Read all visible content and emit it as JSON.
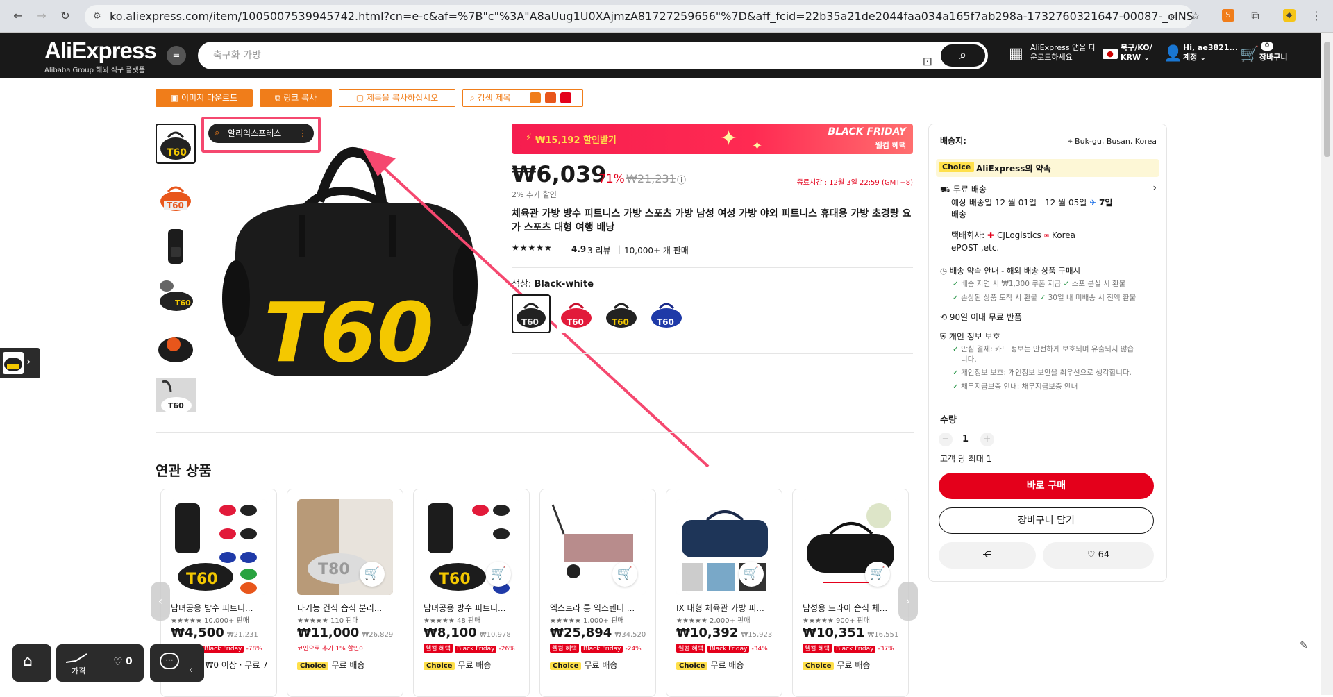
{
  "browser": {
    "url": "ko.aliexpress.com/item/1005007539945742.html?cn=e-c&af=%7B\"c\"%3A\"A8aUug1U0XAjmzA81727259656\"%7D&aff_fcid=22b35a21de2044faa034a165f7ab298a-1732760321647-00087-_oINSwJF&aff_fsk=_oINSwJF&aff_pla..."
  },
  "header": {
    "logo": "AliExpress",
    "logo_sub": "Alibaba Group 해외 직구 플랫폼",
    "search_placeholder": "축구화 가방",
    "app_download_1": "AliExpress 앱을 다",
    "app_download_2": "운로드하세요",
    "region_1": "북구/KO/",
    "region_2": "KRW ⌄",
    "account_1": "Hi, ae3821...",
    "account_2": "계정 ⌄",
    "cart_count": "0",
    "cart_label": "장바구니"
  },
  "actions": {
    "download_images": "이미지 다운로드",
    "copy_link": "링크 복사",
    "copy_title": "제목을 복사하십시오",
    "search_title": "검색 제목"
  },
  "gallery": {
    "ali_tool": "알리익스프레스",
    "bag_text": "T60"
  },
  "product": {
    "banner_coupon": "₩15,192 할인받기",
    "banner_event_1": "BLACK FRIDAY",
    "banner_event_2": "웰컴 혜택",
    "price": "₩6,039",
    "discount": "71%",
    "original_price": "₩21,231",
    "extra_discount": "2% 추가 할인",
    "end_time": "종료시간 : 12월 3일 22:59 (GMT+8)",
    "title": "체육관 가방 방수 피트니스 가방 스포츠 가방 남성 여성 가방 야외 피트니스 휴대용 가방 초경량 요가 스포츠 대형 여행 배낭",
    "rating": "4.9",
    "reviews": "3 리뷰",
    "sold": "10,000+ 개 판매",
    "color_label": "색상: ",
    "color_value": "Black-white"
  },
  "shipping": {
    "ship_to_label": "배송지:",
    "ship_to": "Buk-gu, Busan, Korea",
    "choice_badge": "Choice",
    "promise": "AliExpress의 약속",
    "free_ship": "무료 배송",
    "eta_1": "예상 배송일  12 월 01일 - 12 월 05일",
    "eta_days": "7일",
    "eta_2": "배송",
    "carrier_label": "택배회사:",
    "carrier_1": "CJLogistics",
    "carrier_2": "Korea",
    "carrier_3": "ePOST ,etc.",
    "guarantee_title": "배송 약속 안내 - 해외 배송 상품 구매시",
    "g1": "배송 지연 시 ₩1,300 쿠폰 지급",
    "g2": "소포 분실 시 환불",
    "g3": "손상된 상품 도착 시 환불",
    "g4": "30일 내 미배송 시 전액 환불",
    "returns": "90일 이내 무료 반품",
    "privacy_title": "개인 정보 보호",
    "p1": "안심 결제: 카드 정보는 안전하게 보호되며 유출되지 않습",
    "p1b": "니다.",
    "p2": "개인정보 보호: 개인정보 보안을 최우선으로 생각합니다.",
    "p3": "채무지급보증 안내: 채무지급보증 안내",
    "qty_label": "수량",
    "qty": "1",
    "qty_max": "고객 당 최대 1",
    "buy_now": "바로 구매",
    "add_cart": "장바구니 담기",
    "wishlist_count": "64"
  },
  "related": {
    "title": "연관 상품",
    "items": [
      {
        "name": "남녀공용 방수 피트니...",
        "stats": "10,000+ 판매",
        "price": "₩4,500",
        "orig": "₩21,231",
        "tags": "-78%",
        "bottom": "₩0 이상 · 무료 7"
      },
      {
        "name": "다기능 건식 습식 분리...",
        "stats": "110 판매",
        "price": "₩11,000",
        "orig": "₩26,829",
        "tags": "코인으로 추가 1% 할인0",
        "bottom": "무료 배송"
      },
      {
        "name": "남녀공용 방수 피트니...",
        "stats": "48 판매",
        "price": "₩8,100",
        "orig": "₩10,978",
        "tags": "-26%",
        "bottom": "무료 배송"
      },
      {
        "name": "엑스트라 롱 익스텐더 ...",
        "stats": "1,000+ 판매",
        "price": "₩25,894",
        "orig": "₩34,520",
        "tags": "-24%",
        "bottom": "무료 배송"
      },
      {
        "name": "IX 대형 체육관 가방 피...",
        "stats": "2,000+ 판매",
        "price": "₩10,392",
        "orig": "₩15,923",
        "tags": "-34%",
        "bottom": "무료 배송"
      },
      {
        "name": "남성용 드라이 습식 체...",
        "stats": "900+ 판매",
        "price": "₩10,351",
        "orig": "₩16,551",
        "tags": "-37%",
        "bottom": "무료 배송"
      }
    ],
    "tag_welcome": "웰컴 혜택",
    "tag_bf": "Black Friday",
    "choice": "Choice"
  },
  "floating": {
    "price_label": "가격",
    "wish_count": "0"
  },
  "colors": {
    "brand_red": "#e4001b",
    "orange": "#f07d1a",
    "annotation_pink": "#f5486f",
    "choice_yellow": "#ffe04a",
    "bag_yellow": "#f4c800"
  }
}
